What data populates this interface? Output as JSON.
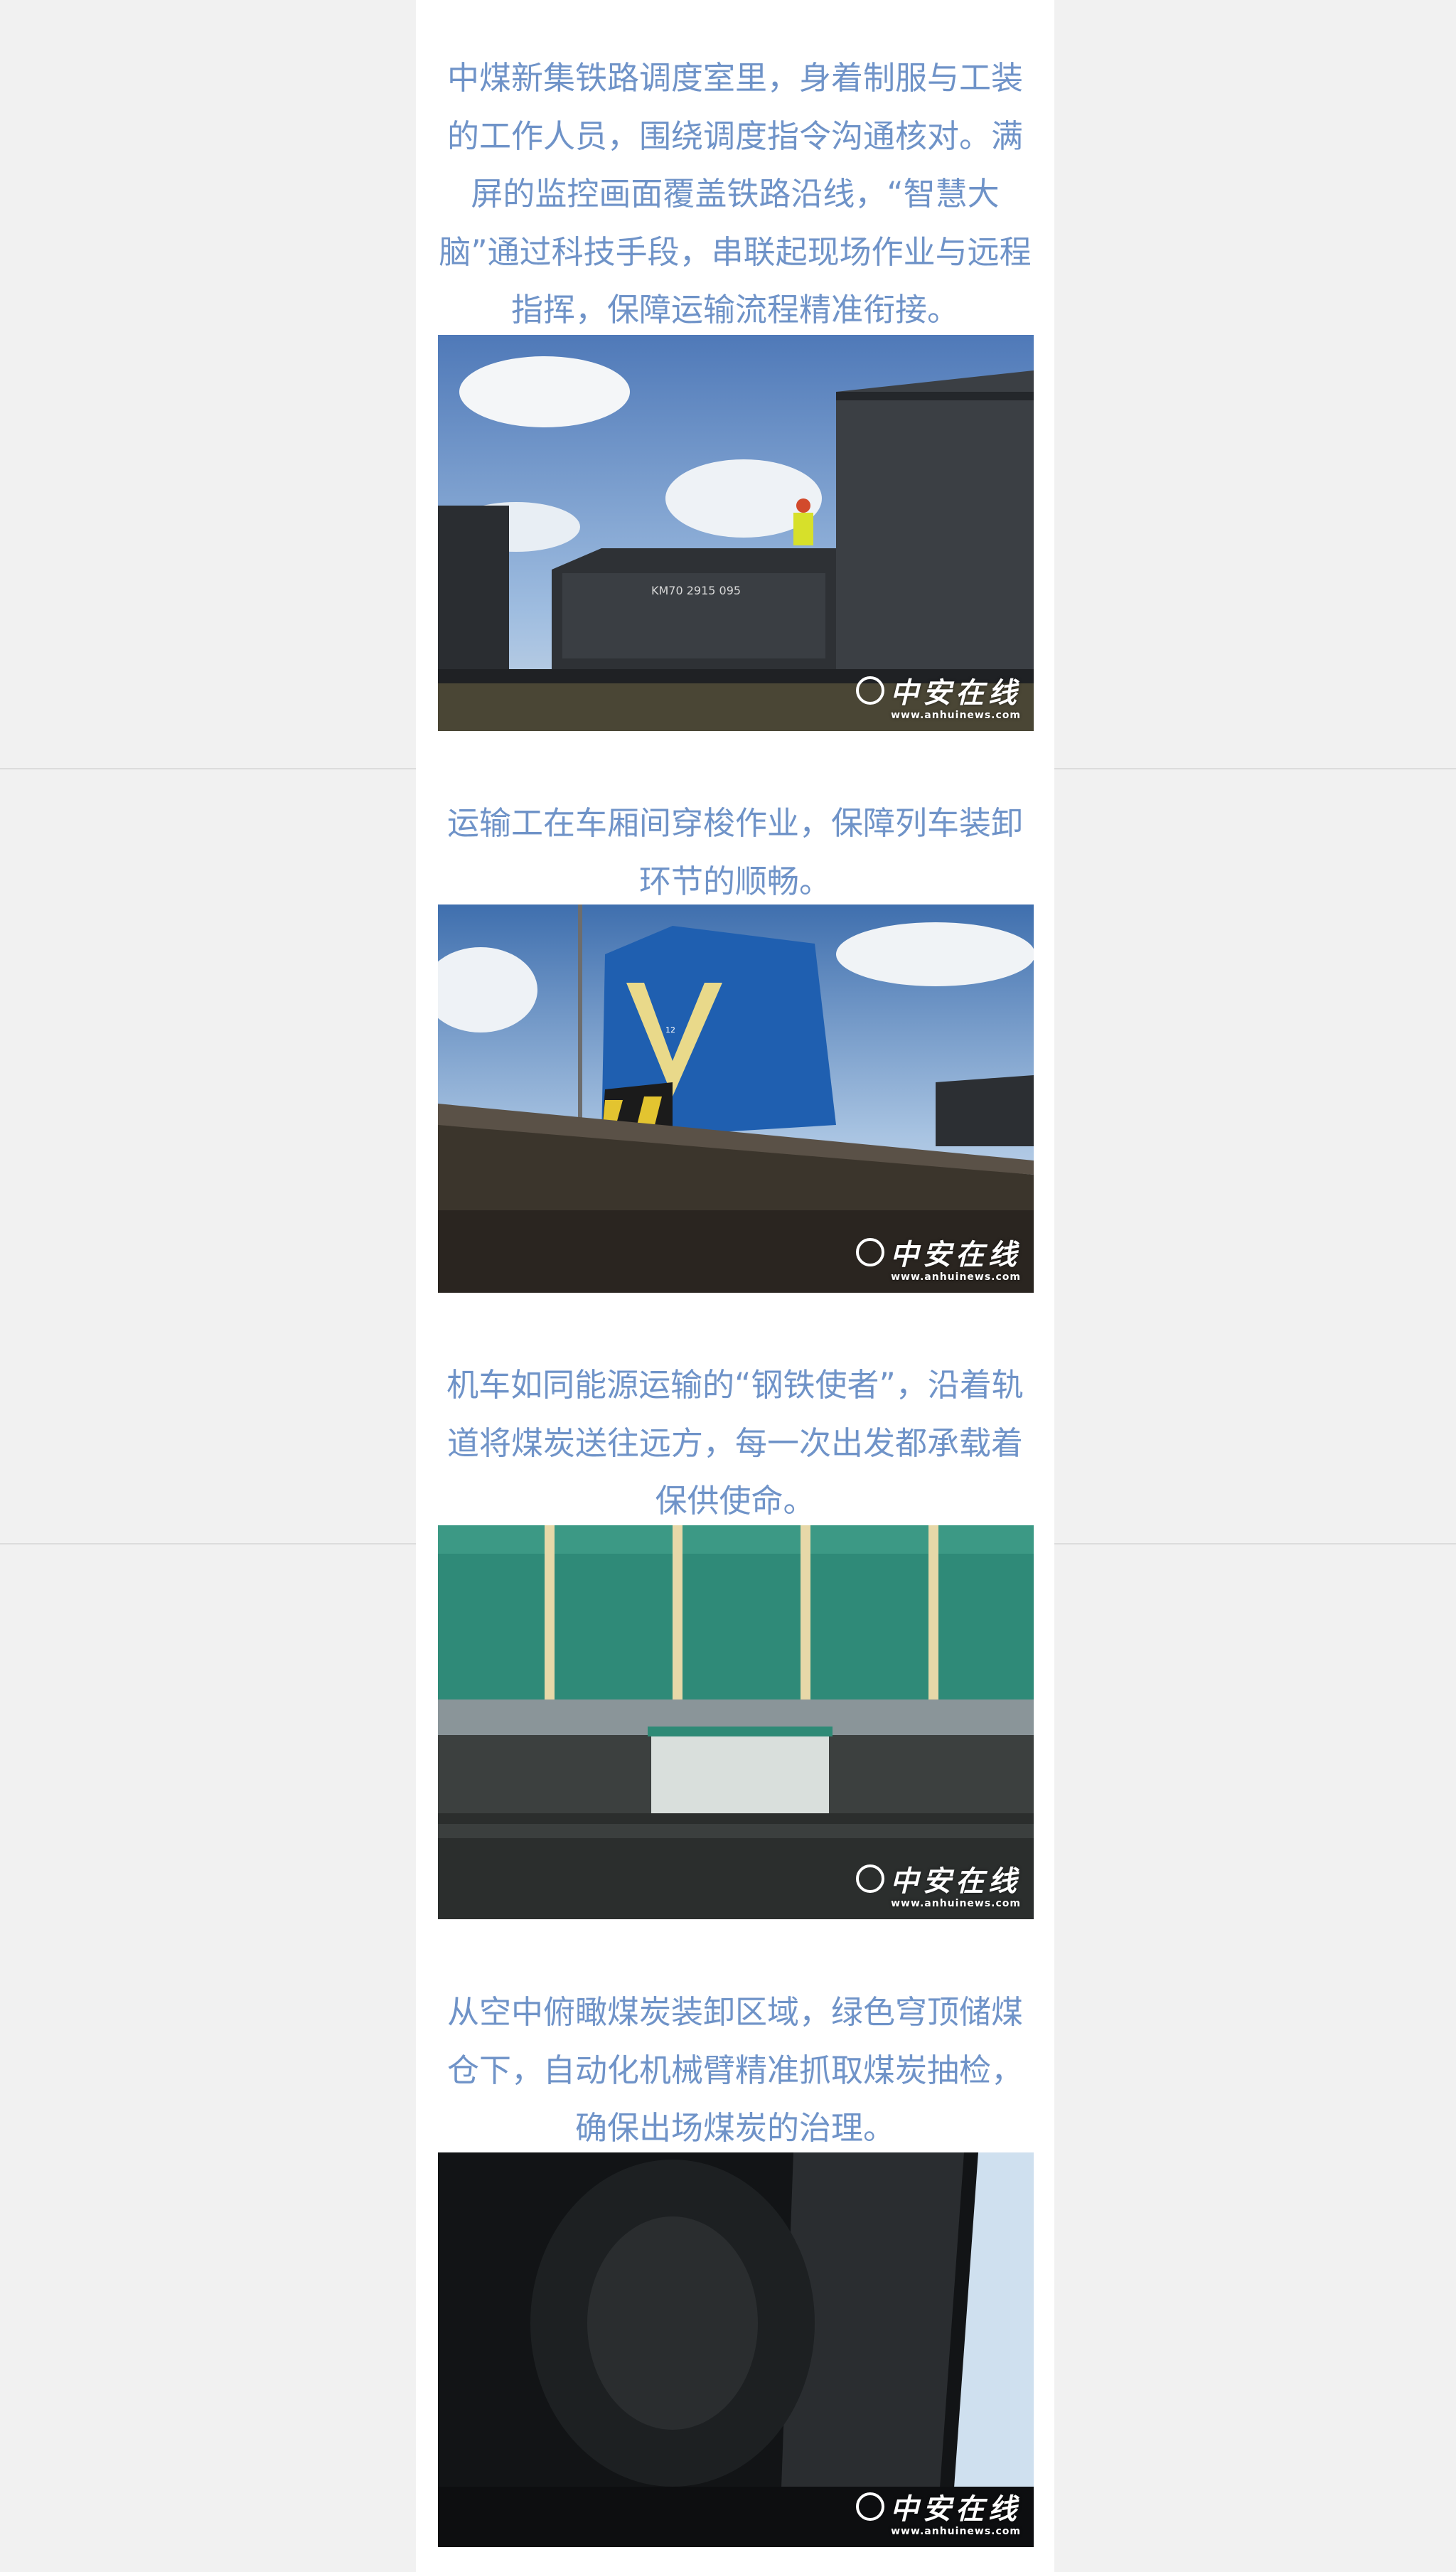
{
  "captions": {
    "dispatch": "中煤新集铁路调度室里，身着制服与工装的工作人员，围绕调度指令沟通核对。满屏的监控画面覆盖铁路沿线，“智慧大脑”通过科技手段，串联起现场作业与远程指挥，保障运输流程精准衔接。",
    "workers": "运输工在车厢间穿梭作业，保障列车装卸环节的顺畅。",
    "locomotive": "机车如同能源运输的“钢铁使者”，沿着轨道将煤炭送往远方，每一次出发都承载着保供使命。",
    "aerial": "从空中俯瞰煤炭装卸区域，绿色穹顶储煤仓下，自动化机械臂精准抓取煤炭抽检，确保出场煤炭的治理。"
  },
  "watermark": {
    "brand": "中安在线",
    "site": "www.anhuinews.com"
  },
  "photos": {
    "wagon_marking": "KM70 2915 095",
    "loco_number": "12"
  },
  "colors": {
    "caption_text": "#6f93c8",
    "page_background": "#f1f1f1",
    "article_background": "#ffffff"
  }
}
